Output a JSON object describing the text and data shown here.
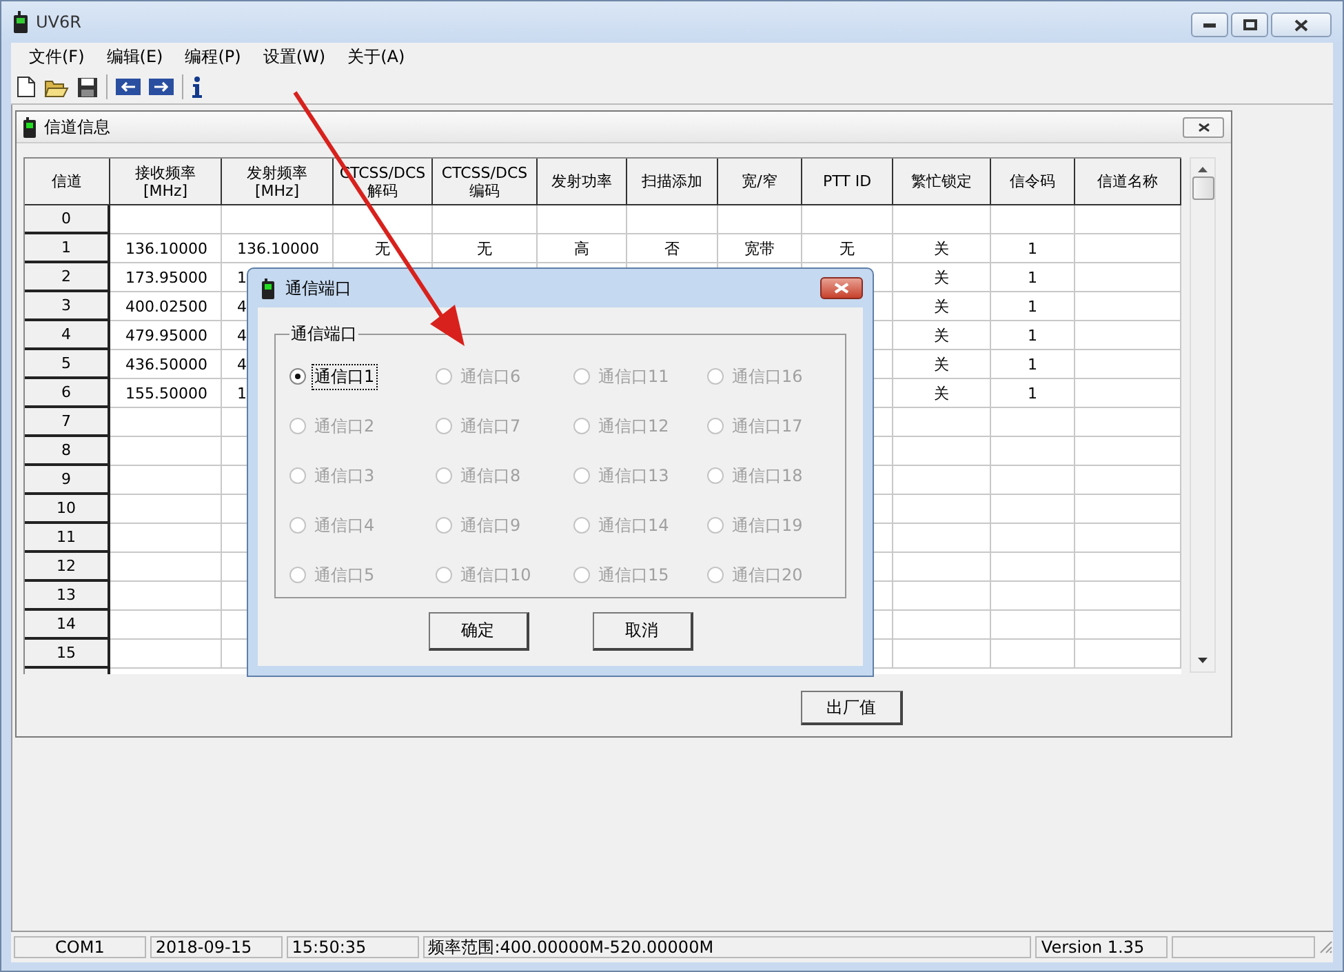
{
  "window": {
    "title": "UV6R"
  },
  "menu": [
    "文件(F)",
    "编辑(E)",
    "编程(P)",
    "设置(W)",
    "关于(A)"
  ],
  "channel_window": {
    "title": "信道信息",
    "columns": [
      "信道",
      "接收频率\n[MHz]",
      "发射频率\n[MHz]",
      "CTCSS/DCS\n解码",
      "CTCSS/DCS\n编码",
      "发射功率",
      "扫描添加",
      "宽/窄",
      "PTT ID",
      "繁忙锁定",
      "信令码",
      "信道名称"
    ],
    "rows": [
      [
        "0"
      ],
      [
        "1",
        "136.10000",
        "136.10000",
        "无",
        "无",
        "高",
        "否",
        "宽带",
        "无",
        "关",
        "1"
      ],
      [
        "2",
        "173.95000",
        "1",
        null,
        null,
        null,
        null,
        null,
        null,
        "关",
        "1"
      ],
      [
        "3",
        "400.02500",
        "4",
        null,
        null,
        null,
        null,
        null,
        null,
        "关",
        "1"
      ],
      [
        "4",
        "479.95000",
        "4",
        null,
        null,
        null,
        null,
        null,
        null,
        "关",
        "1"
      ],
      [
        "5",
        "436.50000",
        "4",
        null,
        null,
        null,
        null,
        null,
        null,
        "关",
        "1"
      ],
      [
        "6",
        "155.50000",
        "1",
        null,
        null,
        null,
        null,
        null,
        null,
        "关",
        "1"
      ],
      [
        "7"
      ],
      [
        "8"
      ],
      [
        "9"
      ],
      [
        "10"
      ],
      [
        "11"
      ],
      [
        "12"
      ],
      [
        "13"
      ],
      [
        "14"
      ],
      [
        "15"
      ]
    ],
    "factory_button": "出厂值"
  },
  "dialog": {
    "title": "通信端口",
    "group_label": "通信端口",
    "ports": [
      {
        "label": "通信口1",
        "selected": true,
        "disabled": false
      },
      {
        "label": "通信口2",
        "selected": false,
        "disabled": true
      },
      {
        "label": "通信口3",
        "selected": false,
        "disabled": true
      },
      {
        "label": "通信口4",
        "selected": false,
        "disabled": true
      },
      {
        "label": "通信口5",
        "selected": false,
        "disabled": true
      },
      {
        "label": "通信口6",
        "selected": false,
        "disabled": true
      },
      {
        "label": "通信口7",
        "selected": false,
        "disabled": true
      },
      {
        "label": "通信口8",
        "selected": false,
        "disabled": true
      },
      {
        "label": "通信口9",
        "selected": false,
        "disabled": true
      },
      {
        "label": "通信口10",
        "selected": false,
        "disabled": true
      },
      {
        "label": "通信口11",
        "selected": false,
        "disabled": true
      },
      {
        "label": "通信口12",
        "selected": false,
        "disabled": true
      },
      {
        "label": "通信口13",
        "selected": false,
        "disabled": true
      },
      {
        "label": "通信口14",
        "selected": false,
        "disabled": true
      },
      {
        "label": "通信口15",
        "selected": false,
        "disabled": true
      },
      {
        "label": "通信口16",
        "selected": false,
        "disabled": true
      },
      {
        "label": "通信口17",
        "selected": false,
        "disabled": true
      },
      {
        "label": "通信口18",
        "selected": false,
        "disabled": true
      },
      {
        "label": "通信口19",
        "selected": false,
        "disabled": true
      },
      {
        "label": "通信口20",
        "selected": false,
        "disabled": true
      }
    ],
    "buttons": [
      "确定",
      "取消"
    ]
  },
  "status_bar": [
    "COM1",
    "2018-09-15",
    "15:50:35",
    "频率范围:400.00000M-520.00000M",
    "Version 1.35"
  ]
}
